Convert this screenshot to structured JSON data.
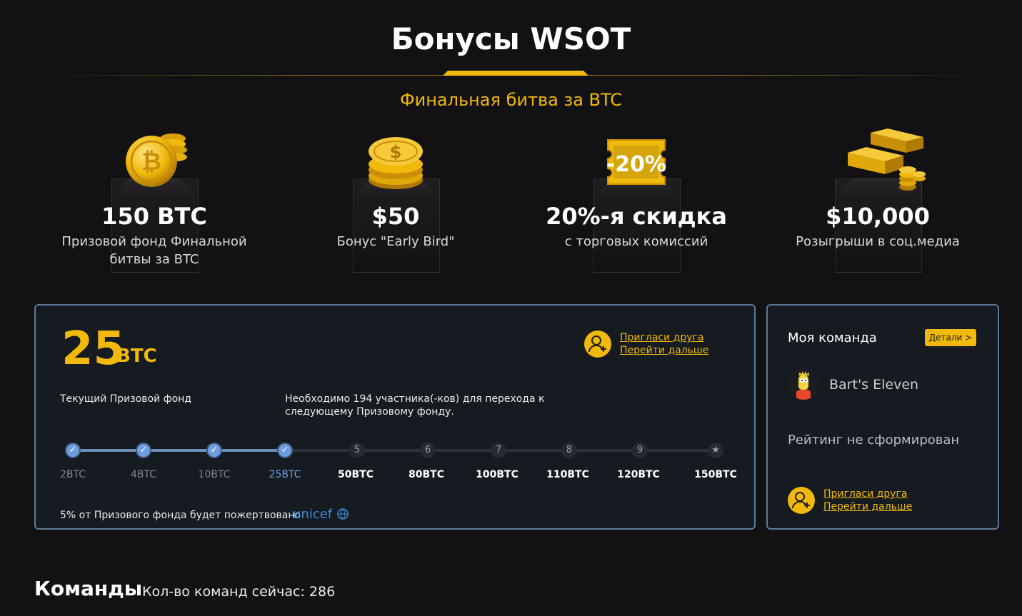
{
  "header": {
    "title": "Бонусы WSOT",
    "subtitle": "Финальная битва за BTC"
  },
  "bonuses": [
    {
      "value": "150 BTC",
      "desc": "Призовой фонд Финальной битвы за BTC",
      "icon": "bitcoin-coins-icon"
    },
    {
      "value": "$50",
      "desc": "Бонус \"Early Bird\"",
      "icon": "dollar-coins-icon"
    },
    {
      "value": "20%-я скидка",
      "desc": "с торговых комиссий",
      "icon": "discount-tag-icon",
      "tag_text": "-20%"
    },
    {
      "value": "$10,000",
      "desc": "Розыгрыши в соц.медиа",
      "icon": "gold-bars-icon"
    }
  ],
  "prize": {
    "amount": "25",
    "unit": "BTC",
    "current_label": "Текущий Призовой фонд",
    "needed_text": "Необходимо 194 участника(-ков) для перехода к следующему Призовому фонду.",
    "invite_line1": "Пригласи друга",
    "invite_line2": "Перейти дальше",
    "steps": [
      {
        "label": "2BTC",
        "marker": "✓",
        "state": "done"
      },
      {
        "label": "4BTC",
        "marker": "✓",
        "state": "done"
      },
      {
        "label": "10BTC",
        "marker": "✓",
        "state": "done"
      },
      {
        "label": "25BTC",
        "marker": "✓",
        "state": "current"
      },
      {
        "label": "50BTC",
        "marker": "5",
        "state": "todo"
      },
      {
        "label": "80BTC",
        "marker": "6",
        "state": "todo"
      },
      {
        "label": "100BTC",
        "marker": "7",
        "state": "todo"
      },
      {
        "label": "110BTC",
        "marker": "8",
        "state": "todo"
      },
      {
        "label": "120BTC",
        "marker": "9",
        "state": "todo"
      },
      {
        "label": "150BTC",
        "marker": "★",
        "state": "todo"
      }
    ],
    "progress_fraction": 0.333,
    "donation_text": "5% от Призового фонда будет пожертвовано",
    "unicef_label": "unicef"
  },
  "team": {
    "title": "Моя команда",
    "details_label": "Детали >",
    "name": "Bart's Eleven",
    "rating_text": "Рейтинг не сформирован",
    "invite_line1": "Пригласи друга",
    "invite_line2": "Перейти дальше"
  },
  "teams": {
    "title": "Команды",
    "count_text": "Кол-во команд сейчас: 286"
  },
  "colors": {
    "accent": "#f0b90b",
    "panel_border": "#5c7a98",
    "done_step": "#6f9ee0",
    "background": "#121214"
  }
}
